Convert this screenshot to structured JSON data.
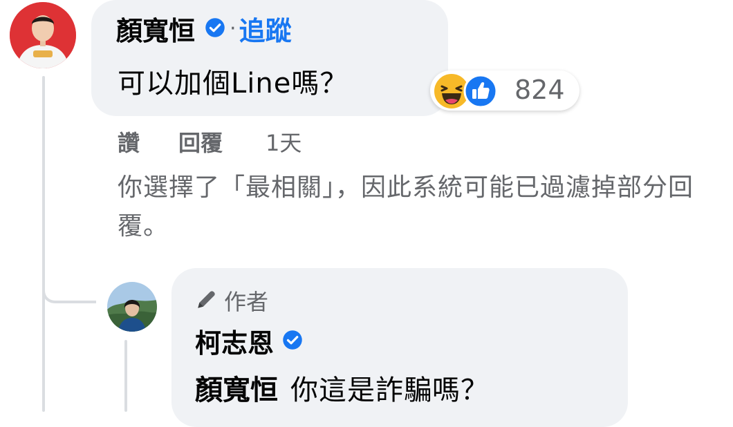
{
  "comment": {
    "author_name": "顏寬恒",
    "follow_separator": "·",
    "follow_label": "追蹤",
    "text": "可以加個Line嗎？",
    "reactions": {
      "icons": [
        "haha-icon",
        "like-icon"
      ],
      "count": "824"
    },
    "actions": {
      "like": "讚",
      "reply": "回覆",
      "time": "1天"
    }
  },
  "filter_notice": "你選擇了「最相關」，因此系統可能已過濾掉部分回覆。",
  "reply": {
    "badge_label": "作者",
    "author_name": "柯志恩",
    "mention": "顏寬恒",
    "text": "你這是詐騙嗎？"
  },
  "colors": {
    "bubble_bg": "#f0f2f5",
    "link_blue": "#1877f2",
    "secondary_text": "#65676b",
    "verified_blue": "#1877f2"
  }
}
